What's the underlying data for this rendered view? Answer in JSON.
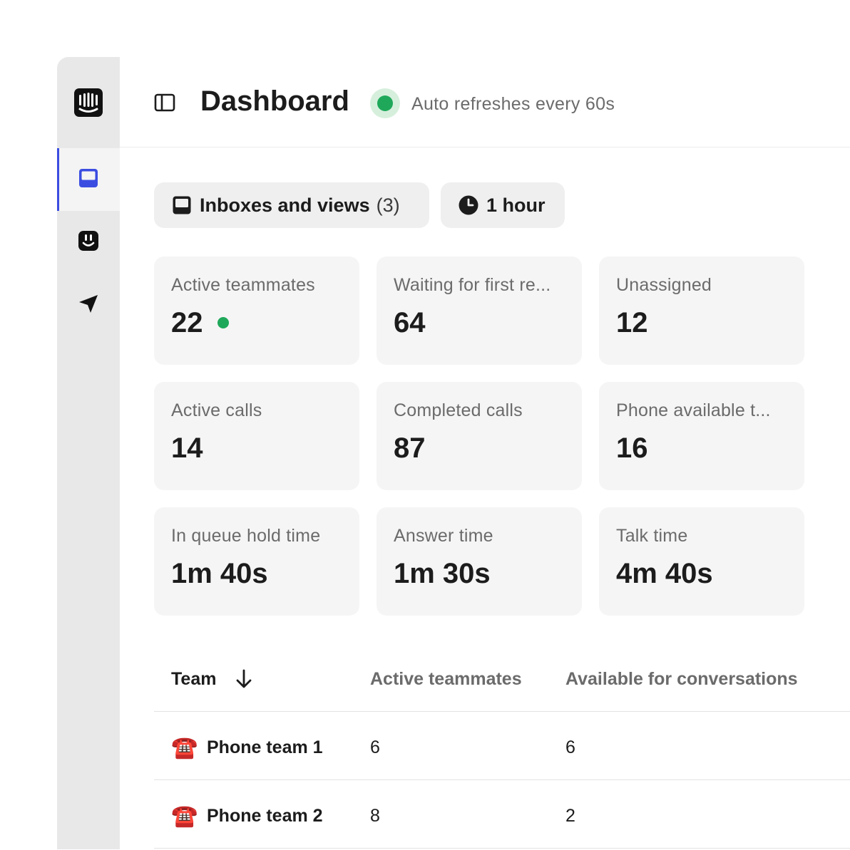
{
  "header": {
    "title": "Dashboard",
    "refresh_text": "Auto refreshes every 60s",
    "status_color": "#1fa85a"
  },
  "sidebar": {
    "items": [
      {
        "name": "intercom-logo-icon"
      },
      {
        "name": "inbox-icon",
        "active": true,
        "accent": "#3b4de1"
      },
      {
        "name": "fin-bot-icon"
      },
      {
        "name": "send-icon"
      }
    ]
  },
  "filters": {
    "inboxes_label": "Inboxes and views",
    "inboxes_count": "(3)",
    "time_label": "1 hour"
  },
  "stats": [
    {
      "label": "Active teammates",
      "value": "22"
    },
    {
      "label": "Waiting for first re...",
      "value": "64"
    },
    {
      "label": "Unassigned",
      "value": "12"
    },
    {
      "label": "Active calls",
      "value": "14"
    },
    {
      "label": "Completed calls",
      "value": "87"
    },
    {
      "label": "Phone available t...",
      "value": "16"
    },
    {
      "label": "In queue hold time",
      "value": "1m 40s"
    },
    {
      "label": "Answer time",
      "value": "1m 30s"
    },
    {
      "label": "Talk time",
      "value": "4m 40s"
    }
  ],
  "table": {
    "columns": [
      "Team",
      "Active teammates",
      "Available for conversations"
    ],
    "rows": [
      {
        "icon": "☎️",
        "team": "Phone team 1",
        "active": "6",
        "available": "6"
      },
      {
        "icon": "☎️",
        "team": "Phone team 2",
        "active": "8",
        "available": "2"
      }
    ]
  }
}
